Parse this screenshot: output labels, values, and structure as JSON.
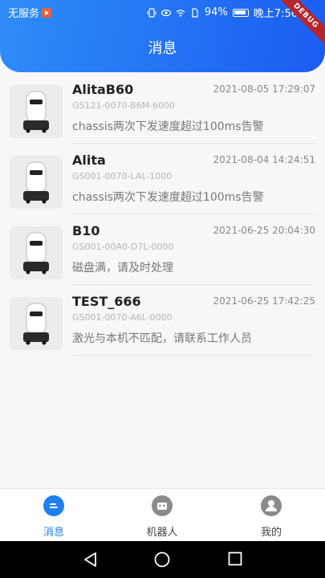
{
  "status_bar": {
    "carrier": "无服务",
    "battery": "94%",
    "time": "晚上7:56"
  },
  "debug_banner": "DEBUG",
  "header": {
    "title": "消息"
  },
  "messages": [
    {
      "name": "AlitaB60",
      "time": "2021-08-05 17:29:07",
      "serial": "GS121-0070-B6M-6000",
      "text": "chassis两次下发速度超过100ms告警"
    },
    {
      "name": "Alita",
      "time": "2021-08-04 14:24:51",
      "serial": "GS001-0070-LAL-1000",
      "text": "chassis两次下发速度超过100ms告警"
    },
    {
      "name": "B10",
      "time": "2021-06-25 20:04:30",
      "serial": "GS001-00A0-D7L-0000",
      "text": "磁盘满，请及时处理"
    },
    {
      "name": "TEST_666",
      "time": "2021-06-25 17:42:25",
      "serial": "GS001-0070-A6L-0000",
      "text": "激光与本机不匹配，请联系工作人员"
    }
  ],
  "bottom_nav": [
    {
      "label": "消息",
      "icon": "chat-icon",
      "active": true
    },
    {
      "label": "机器人",
      "icon": "robot-icon",
      "active": false
    },
    {
      "label": "我的",
      "icon": "profile-icon",
      "active": false
    }
  ],
  "colors": {
    "accent": "#1f7ef0",
    "header_start": "#2f8df6",
    "header_end": "#1a5cf2",
    "debug": "#b5252b"
  }
}
